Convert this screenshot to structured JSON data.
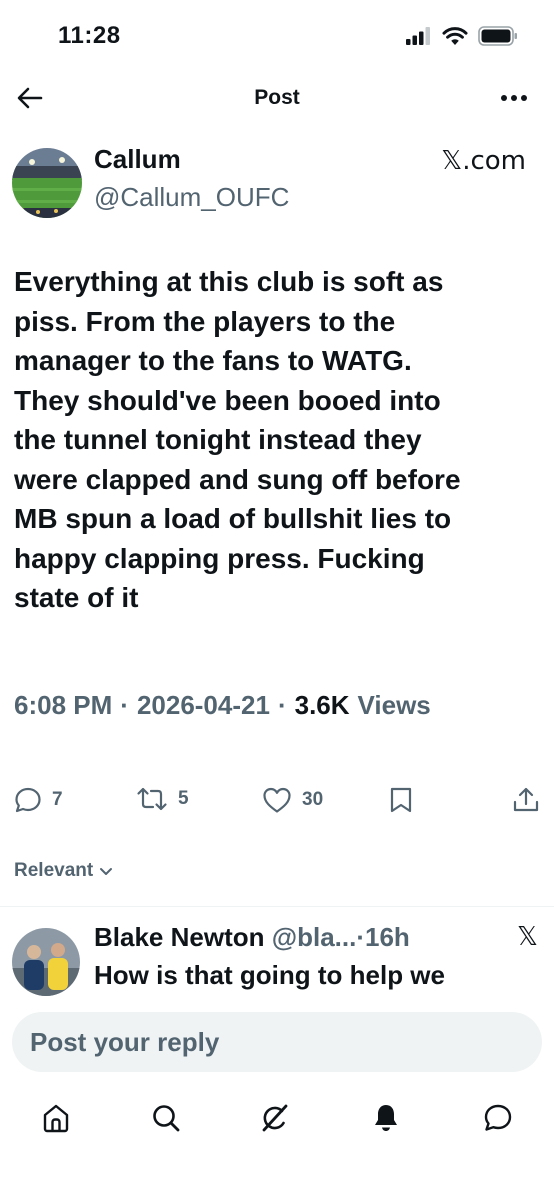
{
  "status_bar": {
    "time": "11:28",
    "icons": [
      "signal-icon",
      "wifi-icon",
      "battery-icon"
    ]
  },
  "header": {
    "title": "Post",
    "back_icon": "arrow-left-icon",
    "more_icon": "more-icon"
  },
  "post": {
    "author_name": "Callum",
    "author_handle": "@Callum_OUFC",
    "source": "𝕏.com",
    "text": "Everything at this club is soft as\npiss. From the players to the\nmanager to the fans to WATG.\nThey should've been booed into\nthe tunnel tonight instead they\nwere clapped and sung off before\nMB spun a load of bullshit lies to\nhappy clapping press. Fucking\nstate of it",
    "time": "6:08 PM",
    "date": "2026-04-21",
    "sep": "·",
    "views_count": "3.6K",
    "views_label": "Views"
  },
  "actions": {
    "replies": "7",
    "reposts": "5",
    "likes": "30"
  },
  "sort": {
    "label": "Relevant"
  },
  "reply": {
    "name": "Blake Newton",
    "handle": "@bla...",
    "dot": "·",
    "time": "16h",
    "source": "𝕏",
    "text": "How is that going to help we"
  },
  "composer": {
    "placeholder": "Post your reply"
  },
  "tabbar": {
    "tabs": [
      "home-icon",
      "search-icon",
      "grok-icon",
      "notifications-icon",
      "messages-icon"
    ]
  },
  "colors": {
    "text": "#0f1419",
    "secondary": "#536471",
    "surface": "#eff3f4"
  }
}
